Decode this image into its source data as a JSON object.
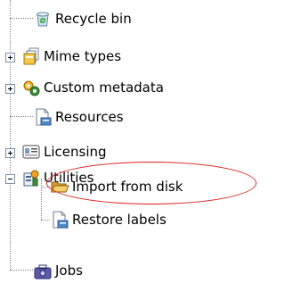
{
  "tree": {
    "items": [
      {
        "label": "Recycle bin",
        "icon": "recycle-bin-icon",
        "expander": "none"
      },
      {
        "label": "Mime types",
        "icon": "mime-types-icon",
        "expander": "plus"
      },
      {
        "label": "Custom metadata",
        "icon": "custom-metadata-icon",
        "expander": "plus"
      },
      {
        "label": "Resources",
        "icon": "resources-icon",
        "expander": "none"
      },
      {
        "label": "Licensing",
        "icon": "licensing-icon",
        "expander": "plus"
      },
      {
        "label": "Utilities",
        "icon": "utilities-icon",
        "expander": "minus",
        "children": [
          {
            "label": "Import from disk",
            "icon": "folder-open-icon"
          },
          {
            "label": "Restore labels",
            "icon": "restore-labels-icon"
          }
        ]
      },
      {
        "label": "Jobs",
        "icon": "jobs-icon",
        "expander": "none"
      }
    ]
  },
  "colors": {
    "highlight_ellipse": "#e02020",
    "tree_lines": "#8a8a8a"
  }
}
